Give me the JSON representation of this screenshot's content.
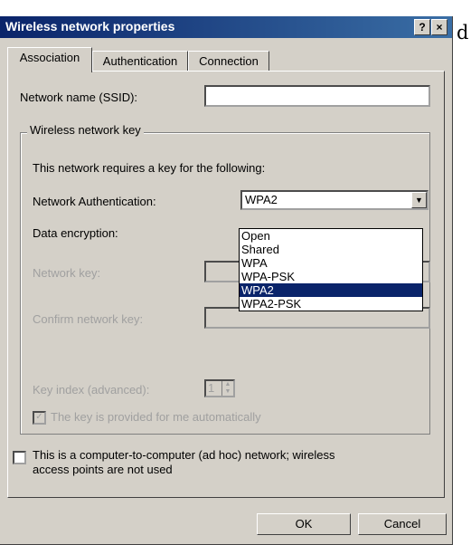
{
  "window": {
    "title": "Wireless network properties",
    "help_button": "?",
    "close_button": "×",
    "side_char": "d"
  },
  "tabs": [
    "Association",
    "Authentication",
    "Connection"
  ],
  "ssid": {
    "label": "Network name (SSID):",
    "value": ""
  },
  "key_group": {
    "title": "Wireless network key",
    "description": "This network requires a key for the following:",
    "auth_label": "Network Authentication:",
    "auth_value": "WPA2",
    "encryption_label": "Data encryption:",
    "auth_options": [
      "Open",
      "Shared",
      "WPA",
      "WPA-PSK",
      "WPA2",
      "WPA2-PSK"
    ],
    "selected_option": "WPA2",
    "network_key_label": "Network key:",
    "confirm_key_label": "Confirm network key:",
    "key_index_label": "Key index (advanced):",
    "key_index_value": "1",
    "auto_key_label": "The key is provided for me automatically"
  },
  "adhoc": {
    "line1": "This is a computer-to-computer (ad hoc) network; wireless",
    "line2": "access points are not used"
  },
  "buttons": {
    "ok": "OK",
    "cancel": "Cancel"
  }
}
